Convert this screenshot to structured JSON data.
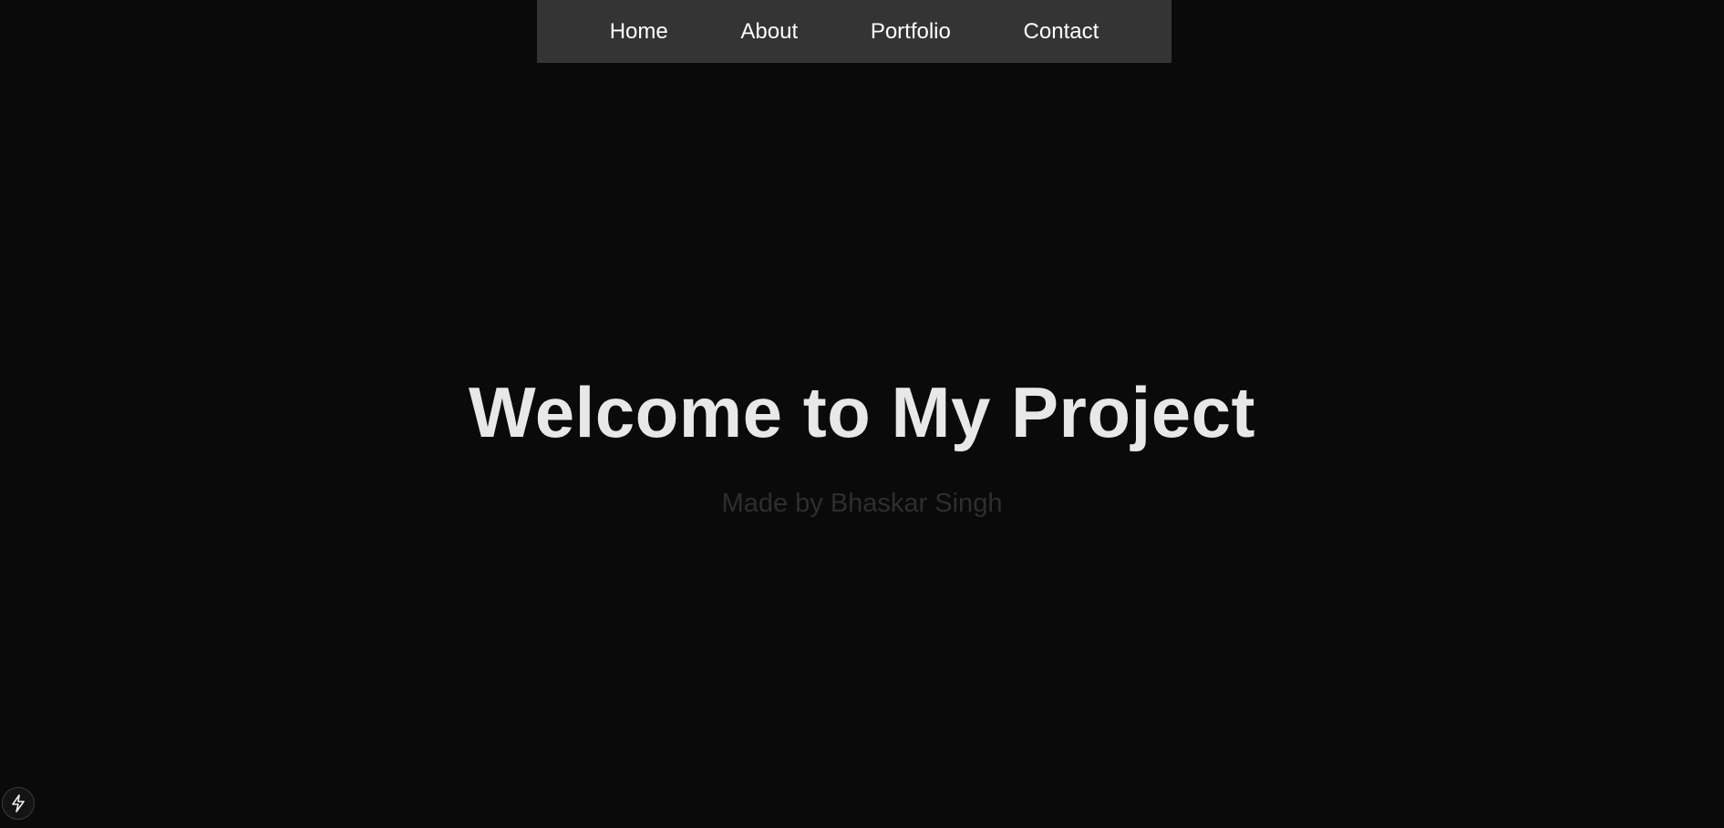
{
  "nav": {
    "items": [
      {
        "label": "Home"
      },
      {
        "label": "About"
      },
      {
        "label": "Portfolio"
      },
      {
        "label": "Contact"
      }
    ]
  },
  "hero": {
    "title": "Welcome to My Project",
    "subtitle": "Made by Bhaskar Singh"
  },
  "badge": {
    "icon": "lightning-bolt-icon"
  },
  "colors": {
    "background": "#0a0a0a",
    "navbar": "#343434",
    "nav_text": "#ffffff",
    "title": "#e8e8e8",
    "subtitle": "#2e2e2e"
  }
}
